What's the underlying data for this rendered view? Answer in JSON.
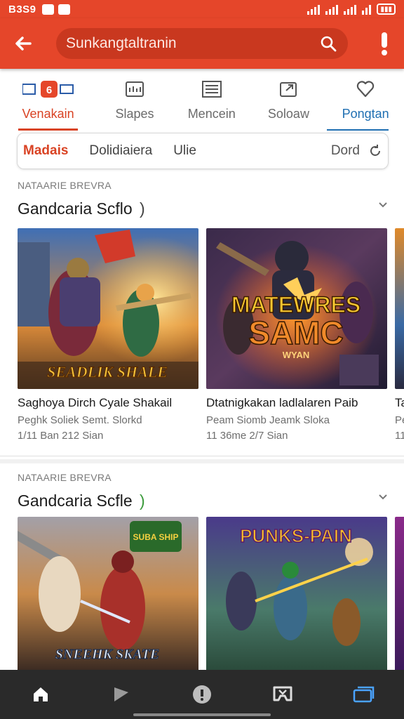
{
  "status_bar": {
    "time": "B3S9"
  },
  "search": {
    "query": "Sunkangtaltranin"
  },
  "categories": [
    {
      "label": "Venakain",
      "icon": "app-logo-icon"
    },
    {
      "label": "Slapes",
      "icon": "grid-icon"
    },
    {
      "label": "Mencein",
      "icon": "list-icon"
    },
    {
      "label": "Soloaw",
      "icon": "share-icon"
    },
    {
      "label": "Pongtan",
      "icon": "heart-icon"
    }
  ],
  "filters": {
    "items": [
      "Madais",
      "Dolidiaiera",
      "Ulie"
    ],
    "right_label": "Dord"
  },
  "sections": [
    {
      "kicker": "NATAARIE BREVRA",
      "title": "Gandcaria Scflo",
      "cards": [
        {
          "title": "Saghoya Dirch Cyale Shakail",
          "sub": "Peghk Soliek   Semt. Slorkd",
          "meta": "1/11 Ban        212 Sian",
          "art_text": "SEADLIK SHALE"
        },
        {
          "title": "Dtatnigkakan ladlalaren Paib",
          "sub": "Peam Siomb    Jeamk Sloka",
          "meta": "11 36me        2/7 Sian",
          "art_text_1": "MATEWRES",
          "art_text_2": "SAMC",
          "art_text_3": "WYAN"
        },
        {
          "title": "Ta",
          "sub": "Pe",
          "meta": "11"
        }
      ]
    },
    {
      "kicker": "NATAARIE BREVRA",
      "title": "Gandcaria Scfle",
      "cards": [
        {
          "art_text": "SNEEHK SKATE",
          "art_badge": "SUBA SHIP"
        },
        {
          "art_text": "PUNKS-PAIN"
        },
        {}
      ]
    }
  ],
  "colors": {
    "accent": "#e5462a",
    "active_tab": "#d94324",
    "blue_tab": "#1f6fb2",
    "nav_bg": "#2a2a2a"
  }
}
